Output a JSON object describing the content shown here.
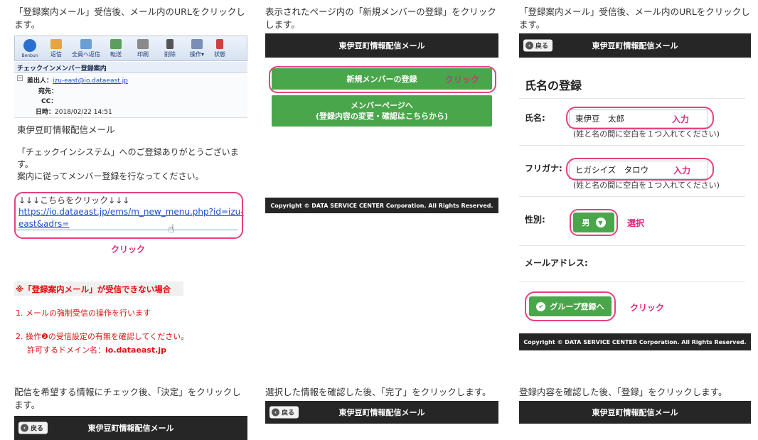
{
  "col1": {
    "caption_l1": "「登録案内メール」受信後、メール内のURLをクリックし",
    "caption_l2": "ます。",
    "toolbar": {
      "buttons": [
        "返信",
        "全員へ返信",
        "転送",
        "印刷",
        "削除",
        "操作▾",
        "状態"
      ],
      "logo": "Benbun"
    },
    "subject": "チェックインメンバー登録案内",
    "from_label": "差出人：",
    "from_value": "izu-east@io.dataeast.jp",
    "to_label": "宛先：",
    "cc_label": "CC：",
    "date_label": "日時：",
    "date_value": "2018/02/22 14:51",
    "body_title": "東伊豆町情報配信メール",
    "body_l1": "「チェックインシステム」へのご登録ありがとうございま",
    "body_l2": "す。",
    "body_l3": "案内に従ってメンバー登録を行なってください。",
    "link_prompt": "↓↓↓こちらをクリック↓↓↓",
    "link_l1": "https://io.dataeast.jp/ems/m_new_menu.php?id=izu-",
    "link_l2": "east&adrs=",
    "click_label": "クリック",
    "warning_title": "※「登録案内メール」が受信できない場合",
    "note1": "1. メールの強制受信の操作を行います",
    "note2": "2. 操作❷の受信設定の有無を確認してください。",
    "note3_prefix": "許可するドメイン名：",
    "note3_domain": "io.dataeast.jp"
  },
  "col2": {
    "caption_l1": "表示されたページ内の「新規メンバーの登録」をクリック",
    "caption_l2": "します。",
    "header_title": "東伊豆町情報配信メール",
    "new_member_button": "新規メンバーの登録",
    "click_label": "クリック",
    "member_page_l1": "メンバーページへ",
    "member_page_l2": "(登録内容の変更・確認はこちらから)",
    "copyright": "Copyright © DATA SERVICE CENTER Corporation. All Rights Reserved."
  },
  "col3": {
    "caption_l1": "「登録案内メール」受信後、メール内のURLをクリックし",
    "caption_l2": "ます。",
    "back_label": "戻る",
    "header_title": "東伊豆町情報配信メール",
    "section_title": "氏名の登録",
    "name_label": "氏名:",
    "name_value": "東伊豆　太郎",
    "input_label": "入力",
    "name_hint": "(姓と名の間に空白を１つ入れてください)",
    "kana_label": "フリガナ:",
    "kana_value": "ヒガシイズ　タロウ",
    "kana_hint": "(姓と名の間に空白を１つ入れてください)",
    "gender_label": "性別:",
    "gender_value": "男",
    "select_label": "選択",
    "email_label": "メールアドレス:",
    "group_button": "グループ登録へ",
    "click_label": "クリック",
    "copyright": "Copyright © DATA SERVICE CENTER Corporation. All Rights Reserved."
  },
  "bottom": {
    "cap4_l1": "配信を希望する情報にチェック後、「決定」をクリックし",
    "cap4_l2": "ます。",
    "cap5": "選択した情報を確認した後、「完了」をクリックします。",
    "cap6": "登録内容を確認した後、「登録」をクリックします。",
    "back_label": "戻る",
    "header_title": "東伊豆町情報配信メール"
  },
  "colors": {
    "green": "#4aa64a",
    "pink": "#e8407f",
    "dark": "#262626",
    "red": "#e01010"
  }
}
